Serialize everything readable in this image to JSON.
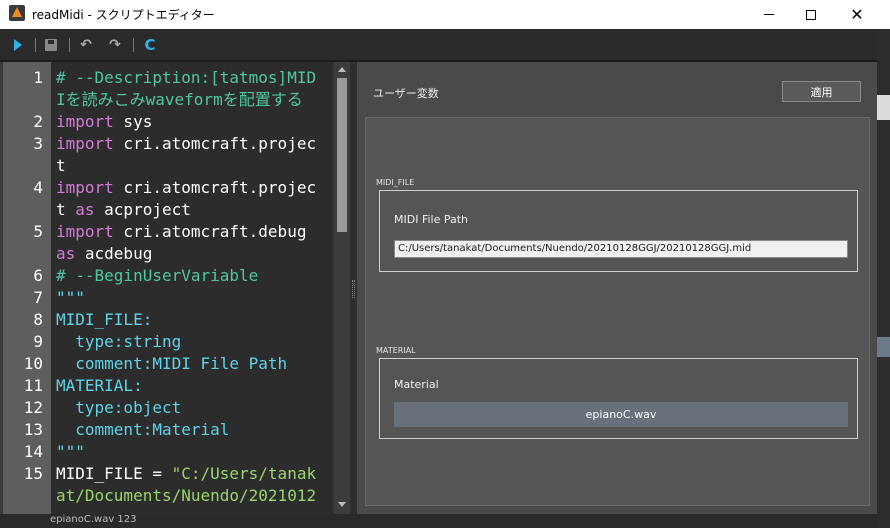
{
  "window": {
    "title": "readMidi - スクリプトエディター",
    "minimize": "—",
    "close": "✕"
  },
  "toolbar": {
    "run_icon": "play-icon",
    "save_icon": "save-icon",
    "undo_icon": "undo-icon",
    "redo_icon": "redo-icon",
    "reload_icon": "reload-icon",
    "undo_glyph": "↶",
    "redo_glyph": "↷",
    "reload_glyph": "C"
  },
  "editor": {
    "lines": [
      {
        "num": "1",
        "segments": [
          {
            "t": "# --Description:[tatmos]MID",
            "c": "comment"
          }
        ]
      },
      {
        "num": "",
        "segments": [
          {
            "t": "Iを読みこみwaveformを配置する",
            "c": "comment"
          }
        ]
      },
      {
        "num": "2",
        "segments": [
          {
            "t": "import",
            "c": "kw"
          },
          {
            "t": " sys",
            "c": "plain"
          }
        ]
      },
      {
        "num": "3",
        "segments": [
          {
            "t": "import",
            "c": "kw"
          },
          {
            "t": " cri.atomcraft.projec",
            "c": "plain"
          }
        ]
      },
      {
        "num": "",
        "segments": [
          {
            "t": "t",
            "c": "plain"
          }
        ]
      },
      {
        "num": "4",
        "segments": [
          {
            "t": "import",
            "c": "kw"
          },
          {
            "t": " cri.atomcraft.projec",
            "c": "plain"
          }
        ]
      },
      {
        "num": "",
        "segments": [
          {
            "t": "t ",
            "c": "plain"
          },
          {
            "t": "as",
            "c": "kw"
          },
          {
            "t": " acproject",
            "c": "plain"
          }
        ]
      },
      {
        "num": "5",
        "segments": [
          {
            "t": "import",
            "c": "kw"
          },
          {
            "t": " cri.atomcraft.debug",
            "c": "plain"
          }
        ]
      },
      {
        "num": "",
        "segments": [
          {
            "t": "as",
            "c": "kw"
          },
          {
            "t": " acdebug",
            "c": "plain"
          }
        ]
      },
      {
        "num": "6",
        "segments": [
          {
            "t": "# --BeginUserVariable",
            "c": "comment"
          }
        ]
      },
      {
        "num": "7",
        "segments": [
          {
            "t": "\"\"\"",
            "c": "cyan"
          }
        ]
      },
      {
        "num": "8",
        "segments": [
          {
            "t": "MIDI_FILE:",
            "c": "cyan"
          }
        ]
      },
      {
        "num": "9",
        "segments": [
          {
            "t": "  type:string",
            "c": "cyan"
          }
        ]
      },
      {
        "num": "10",
        "segments": [
          {
            "t": "  comment:MIDI File Path",
            "c": "cyan"
          }
        ]
      },
      {
        "num": "11",
        "segments": [
          {
            "t": "MATERIAL:",
            "c": "cyan"
          }
        ]
      },
      {
        "num": "12",
        "segments": [
          {
            "t": "  type:object",
            "c": "cyan"
          }
        ]
      },
      {
        "num": "13",
        "segments": [
          {
            "t": "  comment:Material",
            "c": "cyan"
          }
        ]
      },
      {
        "num": "14",
        "segments": [
          {
            "t": "\"\"\"",
            "c": "cyan"
          }
        ]
      },
      {
        "num": "15",
        "segments": [
          {
            "t": "MIDI_FILE = ",
            "c": "plain"
          },
          {
            "t": "\"C:/Users/tanak",
            "c": "str"
          }
        ]
      },
      {
        "num": "",
        "segments": [
          {
            "t": "at/Documents/Nuendo/2021012",
            "c": "str"
          }
        ]
      }
    ]
  },
  "panel": {
    "title": "ユーザー変数",
    "apply_label": "適用",
    "midi_section": "MIDI_FILE",
    "midi_group_label": "MIDI File Path",
    "midi_path_value": "C:/Users/tanakat/Documents/Nuendo/20210128GGJ/20210128GGJ.mid",
    "material_section": "MATERIAL",
    "material_group_label": "Material",
    "material_value": "epianoC.wav"
  },
  "statusbar": {
    "text": "epianoC.wav 123"
  },
  "colors": {
    "comment": "#4fc7a4",
    "keyword": "#d57bd9",
    "cyan": "#5fd3e8",
    "string": "#9ad56b",
    "accent": "#2bb3e6"
  }
}
